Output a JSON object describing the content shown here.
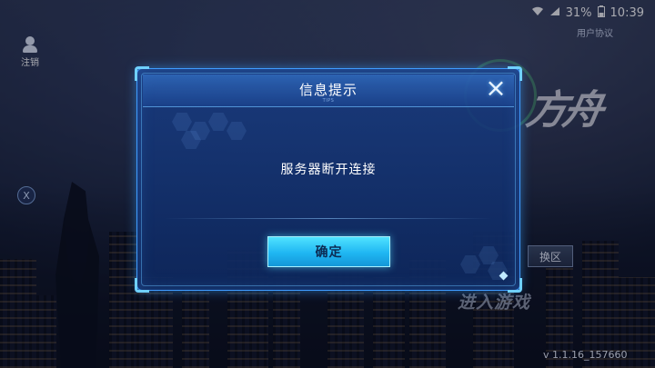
{
  "status_bar": {
    "battery": "31%",
    "time": "10:39"
  },
  "top_left": {
    "logout_label": "注销"
  },
  "top_right": {
    "user_agreement": "用户协议"
  },
  "background": {
    "region_button": "换区",
    "enter_game": "进入游戏",
    "version": "v 1.1.16_157660"
  },
  "dialog": {
    "title": "信息提示",
    "subtitle": "TIPS",
    "message": "服务器断开连接",
    "confirm_label": "确定",
    "close_icon": "×"
  },
  "colors": {
    "dialog_border": "#3f9cff",
    "button": "#1fb6f2",
    "dialog_bg": "#183c82"
  }
}
